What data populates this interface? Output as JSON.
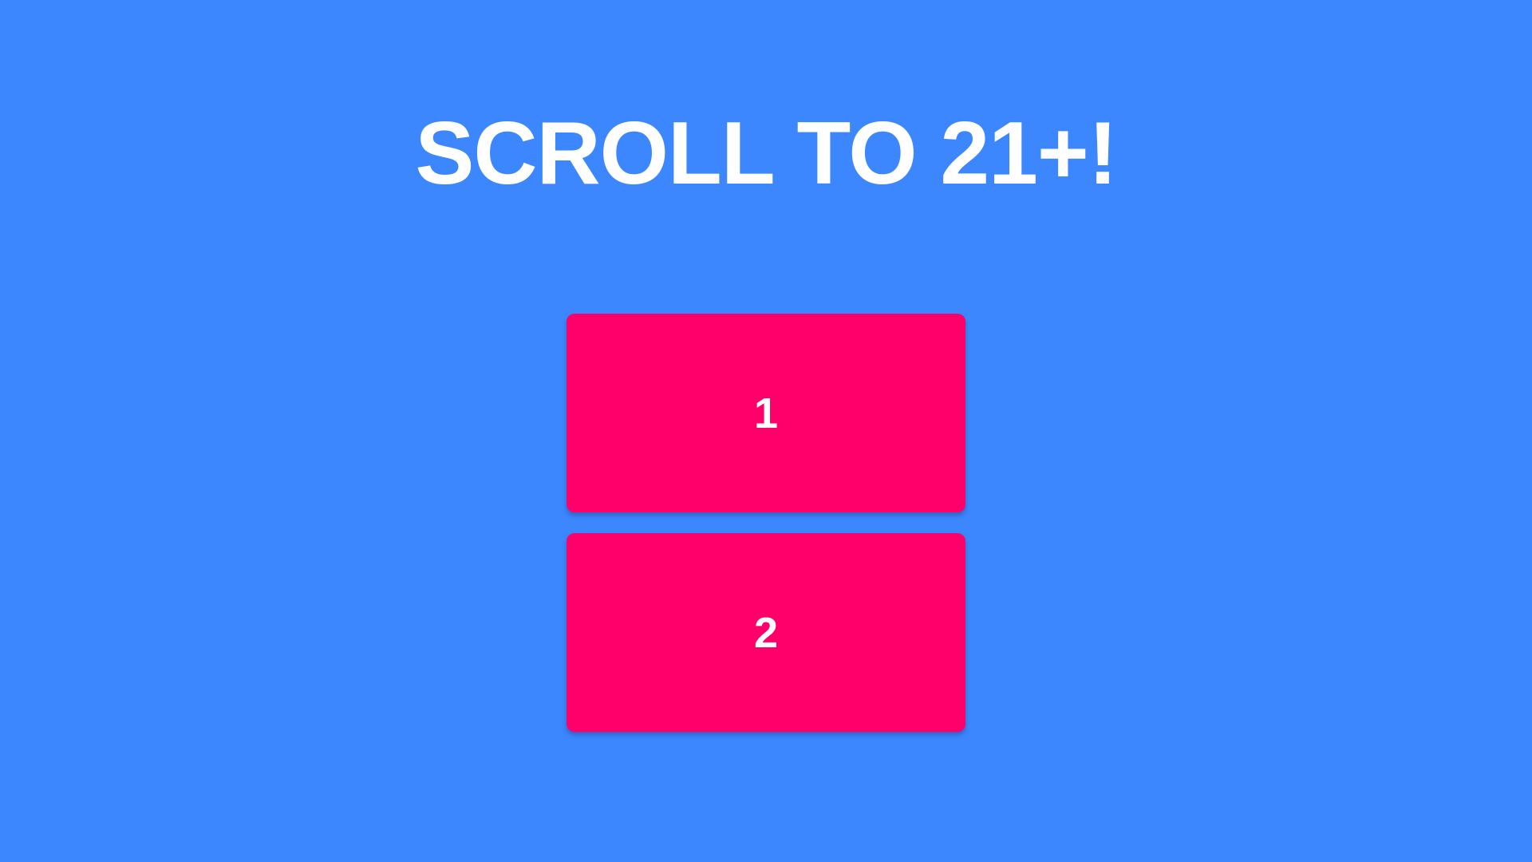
{
  "title": "SCROLL TO 21+!",
  "cards": [
    {
      "label": "1"
    },
    {
      "label": "2"
    }
  ],
  "colors": {
    "background": "#3c87fe",
    "card": "#ff006a",
    "text": "#ffffff"
  }
}
